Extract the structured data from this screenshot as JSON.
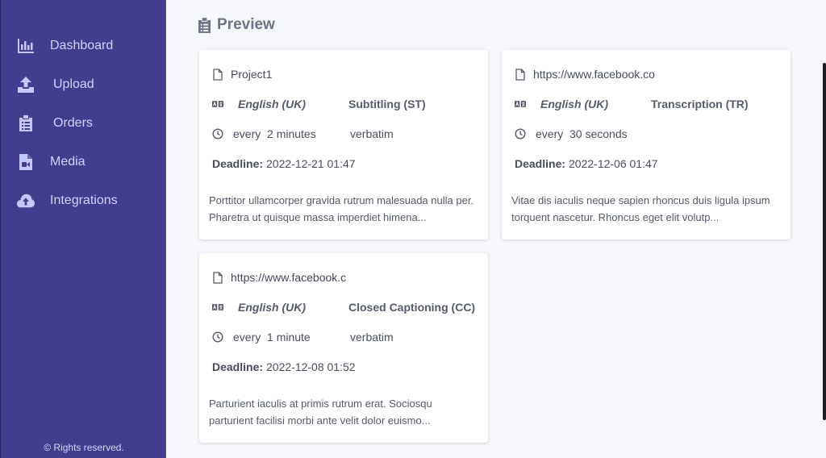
{
  "sidebar": {
    "items": [
      {
        "label": "Dashboard",
        "icon": "chart-bar-icon"
      },
      {
        "label": "Upload",
        "icon": "upload-icon"
      },
      {
        "label": "Orders",
        "icon": "clipboard-list-icon"
      },
      {
        "label": "Media",
        "icon": "file-video-icon"
      },
      {
        "label": "Integrations",
        "icon": "cloud-upload-icon"
      }
    ],
    "footer": "© Rights reserved."
  },
  "page": {
    "title": "Preview",
    "icon": "clipboard-list-icon"
  },
  "deadline_label": "Deadline:",
  "cards": [
    {
      "title": "Project1",
      "language": "English (UK)",
      "service": "Subtitling (ST)",
      "frequency": "every  2 minutes",
      "style": "verbatim",
      "deadline": "2022-12-21 01:47",
      "description": "Porttitor ullamcorper gravida rutrum malesuada nulla per. Pharetra ut quisque massa imperdiet himena..."
    },
    {
      "title": "https://www.facebook.co",
      "language": "English (UK)",
      "service": "Transcription (TR)",
      "frequency": "every  30 seconds",
      "style": "",
      "deadline": "2022-12-06 01:47",
      "description": "Vitae dis iaculis neque sapien rhoncus duis ligula ipsum torquent nascetur. Rhoncus eget elit volutp..."
    },
    {
      "title": "https://www.facebook.c",
      "language": "English (UK)",
      "service": "Closed Captioning (CC)",
      "frequency": "every  1 minute",
      "style": "verbatim",
      "deadline": "2022-12-08 01:52",
      "description": "Parturient iaculis at primis rutrum erat. Sociosqu parturient facilisi morbi ante velit dolor euismo..."
    }
  ]
}
